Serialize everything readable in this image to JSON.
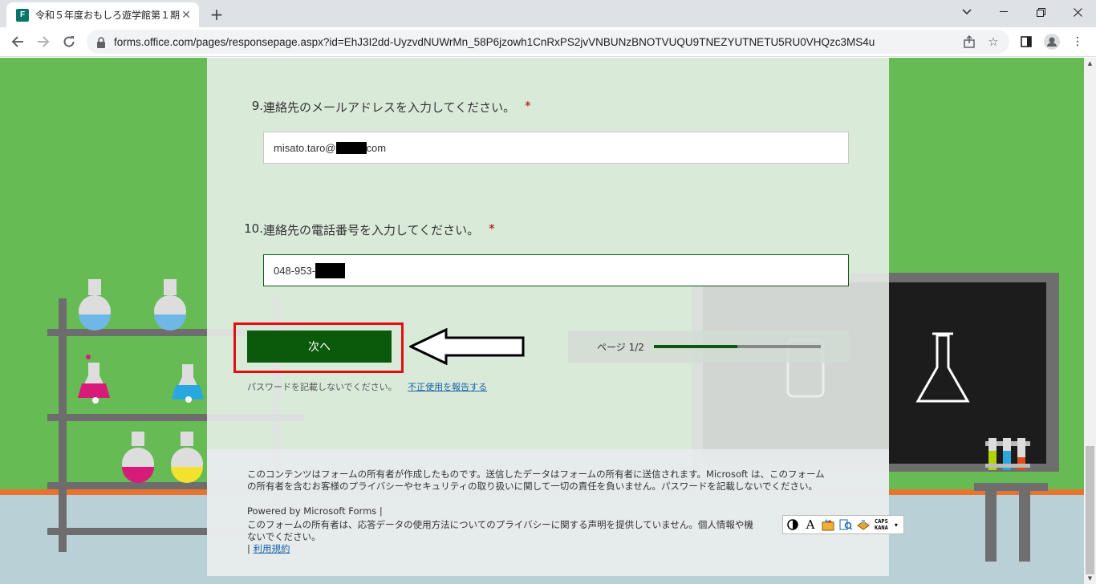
{
  "browser": {
    "tab_title": "令和５年度おもしろ遊学館第１期",
    "favicon_letter": "F",
    "url": "forms.office.com/pages/responsepage.aspx?id=EhJ3I2dd-UyzvdNUWrMn_58P6jzowh1CnRxPS2jvVNBUNzBNOTVUQU9TNEZYUTNETU5RU0VHQzc3MS4u"
  },
  "questions": [
    {
      "number": "9.",
      "title": "連絡先のメールアドレスを入力してください。",
      "required_mark": "*",
      "value_prefix": "misato.taro@",
      "value_suffix": "com"
    },
    {
      "number": "10.",
      "title": "連絡先の電話番号を入力してください。",
      "required_mark": "*",
      "value_prefix": "048-953-",
      "value_suffix": ""
    }
  ],
  "next_button": "次へ",
  "progress": {
    "label": "ページ 1/2",
    "fraction": 0.5
  },
  "notice": {
    "text": "パスワードを記載しないでください。",
    "report_link": "不正使用を報告する"
  },
  "footer": {
    "disclaimer_line1": "このコンテンツはフォームの所有者が作成したものです。送信したデータはフォームの所有者に送信されます。Microsoft は、このフォーム",
    "disclaimer_line2": "の所有者を含むお客様のプライバシーやセキュリティの取り扱いに関して一切の責任を負いません。パスワードを記載しないでください。",
    "powered_by": "Powered by Microsoft Forms |",
    "privacy_line1": "このフォームの所有者は、応答データの使用方法についてのプライバシーに関する声明を提供していません。個人情報や機",
    "privacy_line2": "ないでください。",
    "terms_prefix": "|",
    "terms_link": "利用規約"
  },
  "ime_toolbar": {
    "a_label": "A",
    "caps_label": "CAPS",
    "kana_label": "KANA"
  },
  "colors": {
    "primary": "#0b5a0b",
    "highlight": "#e01010",
    "background": "#66bb55",
    "required": "#a80000",
    "link": "#1a64a8"
  }
}
